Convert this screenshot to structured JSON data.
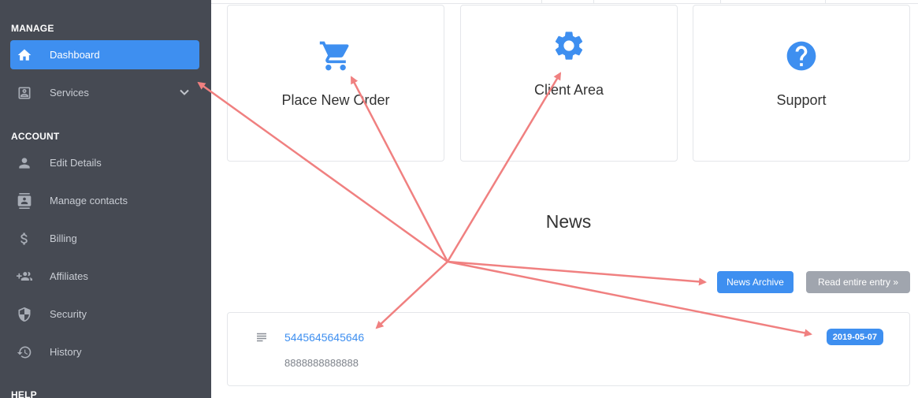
{
  "sidebar": {
    "manage_title": "MANAGE",
    "account_title": "ACCOUNT",
    "help_title": "HELP",
    "items": [
      {
        "label": "Dashboard",
        "icon": "home-icon"
      },
      {
        "label": "Services",
        "icon": "services-icon"
      },
      {
        "label": "Edit Details",
        "icon": "person-icon"
      },
      {
        "label": "Manage contacts",
        "icon": "contacts-icon"
      },
      {
        "label": "Billing",
        "icon": "dollar-icon"
      },
      {
        "label": "Affiliates",
        "icon": "group-add-icon"
      },
      {
        "label": "Security",
        "icon": "shield-icon"
      },
      {
        "label": "History",
        "icon": "history-icon"
      }
    ]
  },
  "cards": [
    {
      "label": "Place New Order",
      "icon": "cart-icon"
    },
    {
      "label": "Client Area",
      "icon": "gear-icon"
    },
    {
      "label": "Support",
      "icon": "help-icon"
    }
  ],
  "news": {
    "title": "News",
    "archive_button": "News Archive",
    "read_button": "Read entire entry »",
    "item": {
      "title": "5445645645646",
      "snippet": "8888888888888",
      "date": "2019-05-07",
      "icon": "lines-icon"
    }
  },
  "colors": {
    "accent": "#3e8ff0",
    "sidebar_bg": "#464a53",
    "annotation_arrows": "#f08080"
  }
}
